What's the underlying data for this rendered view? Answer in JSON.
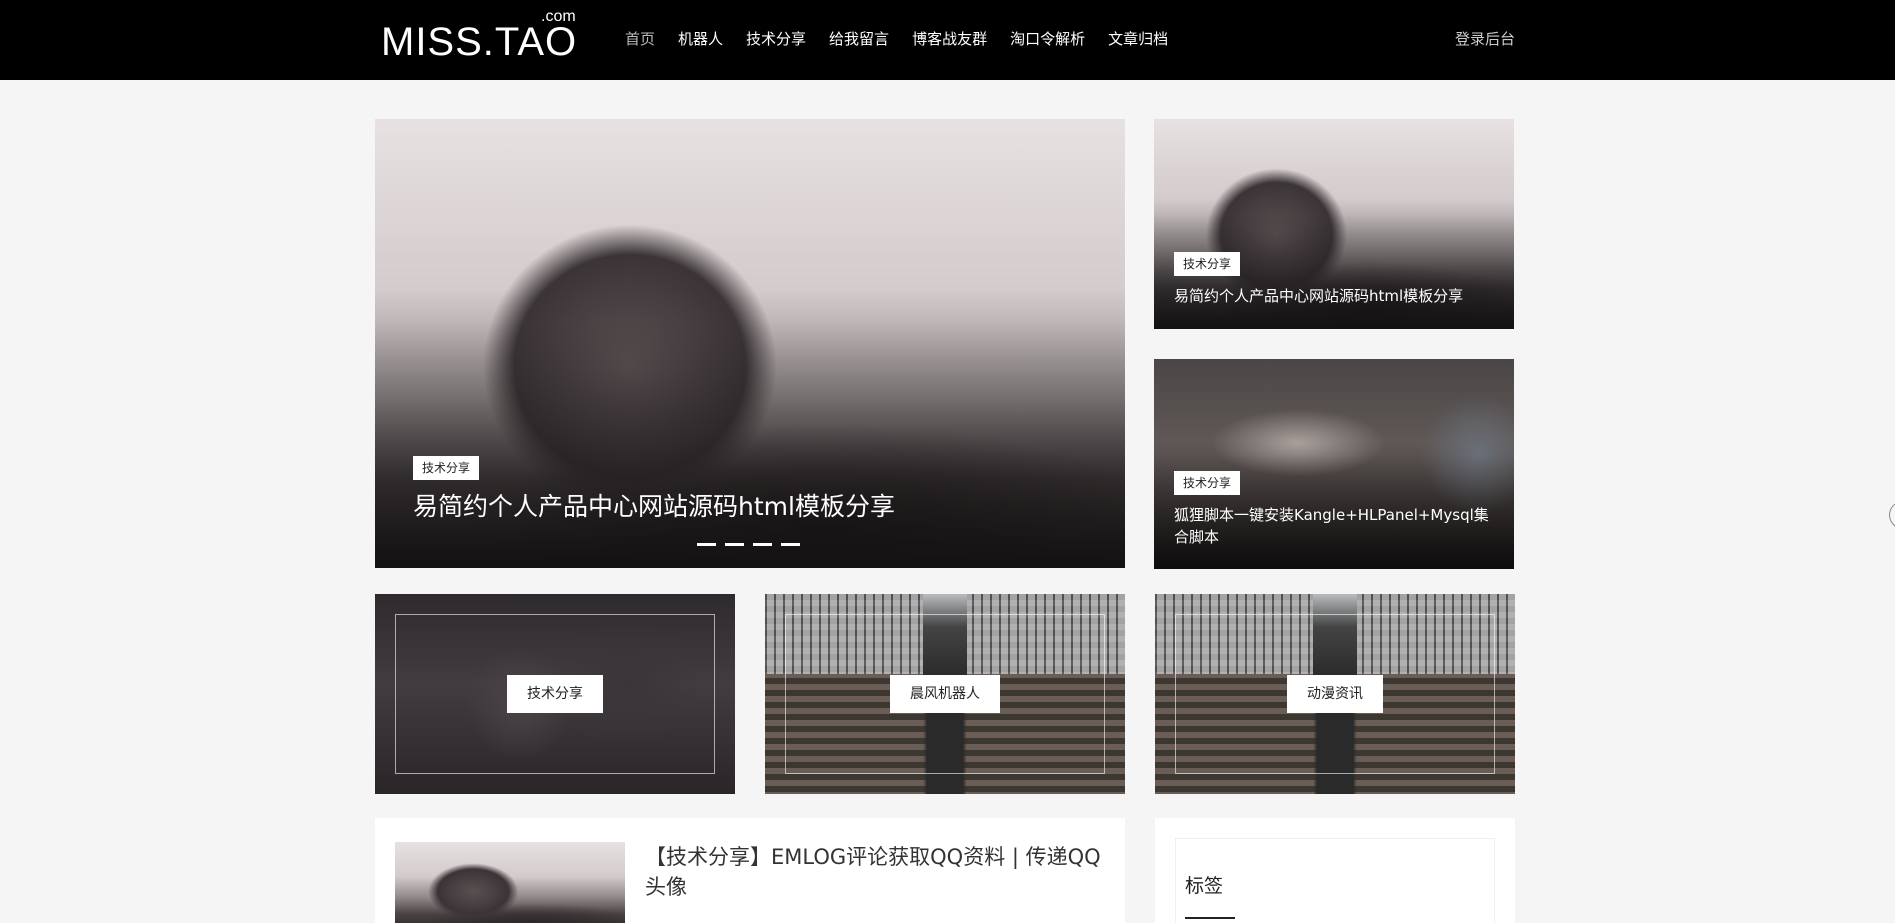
{
  "header": {
    "logo_main": "MISS.TAO",
    "logo_sup": ".com",
    "nav": [
      "首页",
      "机器人",
      "技术分享",
      "给我留言",
      "博客战友群",
      "淘口令解析",
      "文章归档"
    ],
    "login": "登录后台"
  },
  "slider": {
    "tag": "技术分享",
    "title": "易简约个人产品中心网站源码html模板分享",
    "dots": 4
  },
  "side_posts": [
    {
      "tag": "技术分享",
      "title": "易简约个人产品中心网站源码html模板分享"
    },
    {
      "tag": "技术分享",
      "title": "狐狸脚本一键安装Kangle+HLPanel+Mysql集合脚本"
    }
  ],
  "categories": [
    "技术分享",
    "晨风机器人",
    "动漫资讯"
  ],
  "post": {
    "title": "【技术分享】EMLOG评论获取QQ资料 | 传递QQ头像"
  },
  "sidebar": {
    "title": "标签"
  }
}
